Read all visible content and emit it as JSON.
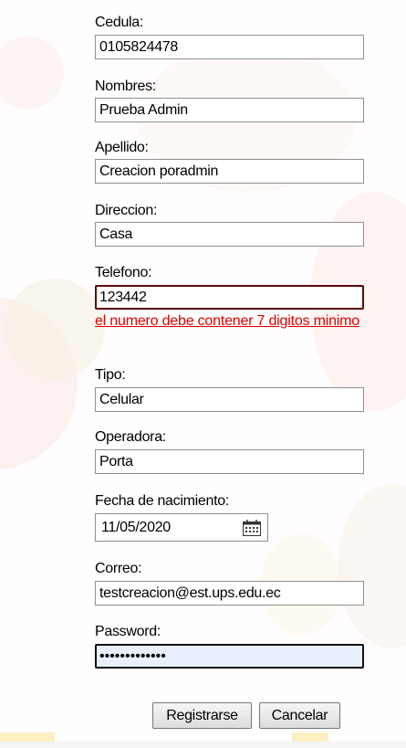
{
  "form": {
    "cedula": {
      "label": "Cedula:",
      "value": "0105824478"
    },
    "nombres": {
      "label": "Nombres:",
      "value": "Prueba Admin"
    },
    "apellido": {
      "label": "Apellido:",
      "value": "Creacion poradmin"
    },
    "direccion": {
      "label": "Direccion:",
      "value": "Casa"
    },
    "telefono": {
      "label": "Telefono:",
      "value": "123442",
      "error": "el numero debe contener 7 digitos minimo"
    },
    "tipo": {
      "label": "Tipo:",
      "value": "Celular"
    },
    "operadora": {
      "label": "Operadora:",
      "value": "Porta"
    },
    "fecha": {
      "label": "Fecha de nacimiento:",
      "value": "11/05/2020",
      "icon": "calendar-icon"
    },
    "correo": {
      "label": "Correo:",
      "value": "testcreacion@est.ups.edu.ec"
    },
    "password": {
      "label": "Password:",
      "value": "•••••••••••••"
    }
  },
  "buttons": {
    "register": "Registrarse",
    "cancel": "Cancelar"
  },
  "colors": {
    "error_text": "#e10000",
    "error_border": "#5a0a0a",
    "focused_bg": "#e8f0fe"
  }
}
